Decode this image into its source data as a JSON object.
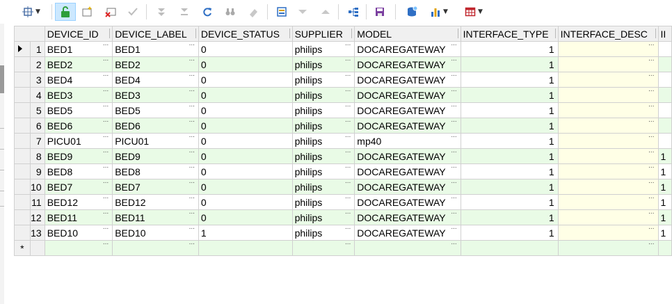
{
  "toolbar": {
    "buttons": [
      {
        "name": "layout-icon"
      },
      {
        "name": "unlock-icon",
        "active": true
      },
      {
        "name": "new-record-icon"
      },
      {
        "name": "delete-record-icon"
      },
      {
        "name": "post-check-icon"
      },
      {
        "name": "last-icon"
      },
      {
        "name": "next-icon"
      },
      {
        "name": "refresh-icon"
      },
      {
        "name": "find-icon"
      },
      {
        "name": "clear-icon"
      },
      {
        "name": "form-icon"
      },
      {
        "name": "down-icon"
      },
      {
        "name": "up-icon"
      },
      {
        "name": "tree-icon"
      },
      {
        "name": "save-icon"
      },
      {
        "name": "query-icon"
      },
      {
        "name": "chart-icon"
      },
      {
        "name": "grid-icon"
      }
    ],
    "dropdown_glyph": "▼"
  },
  "grid": {
    "columns": [
      "DEVICE_ID",
      "DEVICE_LABEL",
      "DEVICE_STATUS",
      "SUPPLIER",
      "MODEL",
      "INTERFACE_TYPE",
      "INTERFACE_DESC",
      "II"
    ],
    "ellipsis": "...",
    "new_row_marker": "*",
    "rows": [
      {
        "n": "1",
        "id": "BED1",
        "label": "BED1",
        "status": "0",
        "supplier": "philips",
        "model": "DOCAREGATEWAY",
        "itype": "1",
        "extra": ""
      },
      {
        "n": "2",
        "id": "BED2",
        "label": "BED2",
        "status": "0",
        "supplier": "philips",
        "model": "DOCAREGATEWAY",
        "itype": "1",
        "extra": ""
      },
      {
        "n": "3",
        "id": "BED4",
        "label": "BED4",
        "status": "0",
        "supplier": "philips",
        "model": "DOCAREGATEWAY",
        "itype": "1",
        "extra": ""
      },
      {
        "n": "4",
        "id": "BED3",
        "label": "BED3",
        "status": "0",
        "supplier": "philips",
        "model": "DOCAREGATEWAY",
        "itype": "1",
        "extra": ""
      },
      {
        "n": "5",
        "id": "BED5",
        "label": "BED5",
        "status": "0",
        "supplier": "philips",
        "model": "DOCAREGATEWAY",
        "itype": "1",
        "extra": ""
      },
      {
        "n": "6",
        "id": "BED6",
        "label": "BED6",
        "status": "0",
        "supplier": "philips",
        "model": "DOCAREGATEWAY",
        "itype": "1",
        "extra": ""
      },
      {
        "n": "7",
        "id": "PICU01",
        "label": "PICU01",
        "status": "0",
        "supplier": "philips",
        "model": "mp40",
        "itype": "1",
        "extra": ""
      },
      {
        "n": "8",
        "id": "BED9",
        "label": "BED9",
        "status": "0",
        "supplier": "philips",
        "model": "DOCAREGATEWAY",
        "itype": "1",
        "extra": "1"
      },
      {
        "n": "9",
        "id": "BED8",
        "label": "BED8",
        "status": "0",
        "supplier": "philips",
        "model": "DOCAREGATEWAY",
        "itype": "1",
        "extra": "1"
      },
      {
        "n": "10",
        "id": "BED7",
        "label": "BED7",
        "status": "0",
        "supplier": "philips",
        "model": "DOCAREGATEWAY",
        "itype": "1",
        "extra": "1"
      },
      {
        "n": "11",
        "id": "BED12",
        "label": "BED12",
        "status": "0",
        "supplier": "philips",
        "model": "DOCAREGATEWAY",
        "itype": "1",
        "extra": "1"
      },
      {
        "n": "12",
        "id": "BED11",
        "label": "BED11",
        "status": "0",
        "supplier": "philips",
        "model": "DOCAREGATEWAY",
        "itype": "1",
        "extra": "1"
      },
      {
        "n": "13",
        "id": "BED10",
        "label": "BED10",
        "status": "1",
        "supplier": "philips",
        "model": "DOCAREGATEWAY",
        "itype": "1",
        "extra": "1"
      }
    ]
  }
}
